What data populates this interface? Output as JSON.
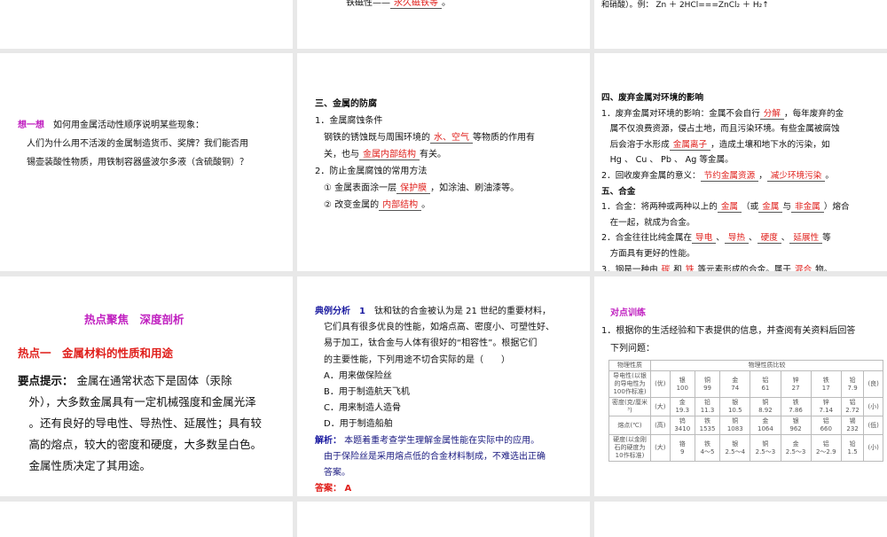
{
  "panels": [
    {
      "id": "p01",
      "lines": []
    },
    {
      "id": "p02",
      "lines": [
        [
          {
            "t": "铁磁性——"
          },
          {
            "t": "永久磁铁等",
            "f": 1
          },
          {
            "t": "。"
          }
        ]
      ]
    },
    {
      "id": "p03",
      "lines": [
        [
          {
            "t": "和硝酸）。例： Zn ＋ 2HCl===ZnCl₂ ＋ H₂↑"
          }
        ]
      ]
    },
    {
      "id": "p11",
      "lines": [
        [
          {
            "t": "想一想",
            "c": "mag"
          },
          {
            "t": "　如何用金属活动性顺序说明某些现象："
          }
        ],
        [
          {
            "t": "　人们为什么用不活泼的金属制造货币、奖牌？我们能否用"
          }
        ],
        [
          {
            "t": "　锡壶装酸性物质，用铁制容器盛波尔多液（含硫酸铜）？"
          }
        ]
      ]
    },
    {
      "id": "p12",
      "lines": [
        [
          {
            "t": "三、金属的防腐",
            "c": "b"
          }
        ],
        [
          {
            "t": "1．金属腐蚀条件"
          }
        ],
        [
          {
            "t": "　钢铁的锈蚀既与周围环境的"
          },
          {
            "t": "水、空气",
            "f": 1
          },
          {
            "t": "等物质的作用有"
          }
        ],
        [
          {
            "t": "　关，也与"
          },
          {
            "t": "金属内部结构",
            "f": 1
          },
          {
            "t": "有关。"
          }
        ],
        [
          {
            "t": "2．防止金属腐蚀的常用方法"
          }
        ],
        [
          {
            "t": "　① 金属表面涂一层"
          },
          {
            "t": "保护膜",
            "f": 1
          },
          {
            "t": "，如涂油、刷油漆等。"
          }
        ],
        [
          {
            "t": "　② 改变金属的"
          },
          {
            "t": "内部结构",
            "f": 1
          },
          {
            "t": "。"
          }
        ]
      ]
    },
    {
      "id": "p13",
      "lines": [
        [
          {
            "t": "四、废弃金属对环境的影响",
            "c": "b"
          }
        ],
        [
          {
            "t": "1．废弃金属对环境的影响：金属不会自行"
          },
          {
            "t": "分解",
            "f": 1
          },
          {
            "t": "，每年废弃的金"
          }
        ],
        [
          {
            "t": "　属不仅浪费资源，侵占土地，而且污染环境。有些金属被腐蚀"
          }
        ],
        [
          {
            "t": "　后会溶于水形成"
          },
          {
            "t": "金属离子",
            "f": 1
          },
          {
            "t": "，造成土壤和地下水的污染，如"
          }
        ],
        [
          {
            "t": "　Hg 、 Cu 、 Pb 、 Ag 等金属。"
          }
        ],
        [
          {
            "t": "2．回收废弃金属的意义："
          },
          {
            "t": "节约金属资源",
            "f": 1
          },
          {
            "t": "，"
          },
          {
            "t": "减少环境污染",
            "f": 1
          },
          {
            "t": "。"
          }
        ],
        [
          {
            "t": "五、合金",
            "c": "b"
          }
        ],
        [
          {
            "t": "1．合金：将两种或两种以上的"
          },
          {
            "t": "金属",
            "f": 1
          },
          {
            "t": "（或"
          },
          {
            "t": "金属",
            "f": 1
          },
          {
            "t": "与"
          },
          {
            "t": "非金属",
            "f": 1
          },
          {
            "t": "）熔合"
          }
        ],
        [
          {
            "t": "　在一起，就成为合金。"
          }
        ],
        [
          {
            "t": "2．合金往往比纯金属在"
          },
          {
            "t": "导电",
            "f": 1
          },
          {
            "t": "、"
          },
          {
            "t": "导热",
            "f": 1
          },
          {
            "t": "、"
          },
          {
            "t": "硬度",
            "f": 1
          },
          {
            "t": "、"
          },
          {
            "t": "延展性",
            "f": 1
          },
          {
            "t": "等"
          }
        ],
        [
          {
            "t": "　方面具有更好的性能。"
          }
        ],
        [
          {
            "t": "3．钢是一种由"
          },
          {
            "t": "碳",
            "f": 1
          },
          {
            "t": "和"
          },
          {
            "t": "铁",
            "f": 1
          },
          {
            "t": "等元素形成的合金。属于"
          },
          {
            "t": "混合",
            "f": 1
          },
          {
            "t": "物。"
          }
        ]
      ]
    },
    {
      "id": "p21",
      "lines": [
        [
          {
            "t": "　　　　　　热点聚焦　深度剖析",
            "c": "mag"
          }
        ],
        [
          {
            "t": "热点一　金属材料的性质和用途",
            "c": "red"
          }
        ],
        [
          {
            "t": "要点提示：",
            "c": "b"
          },
          {
            "t": " 金属在通常状态下是固体（汞除"
          }
        ],
        [
          {
            "t": "　外），大多数金属具有一定机械强度和金属光泽"
          }
        ],
        [
          {
            "t": "　。还有良好的导电性、导热性、延展性；具有较"
          }
        ],
        [
          {
            "t": "　高的熔点，较大的密度和硬度，大多数呈白色。"
          }
        ],
        [
          {
            "t": "　金属性质决定了其用途。"
          }
        ]
      ]
    },
    {
      "id": "p22",
      "lines": [
        [
          {
            "t": "典例分析　1",
            "c": "blue"
          },
          {
            "t": "　钛和钛的合金被认为是 21 世纪的重要材料，"
          }
        ],
        [
          {
            "t": "　它们具有很多优良的性能，如熔点高、密度小、可塑性好、"
          }
        ],
        [
          {
            "t": "　易于加工，钛合金与人体有很好的“相容性”。根据它们"
          }
        ],
        [
          {
            "t": "　的主要性能，下列用途不切合实际的是（　　）"
          }
        ],
        [
          {
            "t": "　A．用来做保险丝"
          }
        ],
        [
          {
            "t": "　B．用于制造航天飞机"
          }
        ],
        [
          {
            "t": "　C．用来制造人造骨"
          }
        ],
        [
          {
            "t": "　D．用于制造船舶"
          }
        ],
        [
          {
            "t": "解析：",
            "c": "blue"
          },
          {
            "t": " 本题着重考查学生理解金属性能在实际中的应用。",
            "c": "navy"
          }
        ],
        [
          {
            "t": "　由于保险丝是采用熔点低的合金材料制成，不难选出正确",
            "c": "navy"
          }
        ],
        [
          {
            "t": "　答案。",
            "c": "navy"
          }
        ],
        [
          {
            "t": "答案： A",
            "c": "red"
          }
        ]
      ]
    },
    {
      "id": "p23",
      "lines": [
        [
          {
            "t": "　对点训练",
            "c": "mag"
          }
        ],
        [
          {
            "t": "1．根据你的生活经验和下表提供的信息，并查阅有关资料后回答"
          }
        ],
        [
          {
            "t": "　下列问题："
          }
        ]
      ]
    }
  ],
  "table": {
    "header": [
      "物理性质",
      "物理性质比较"
    ],
    "rows": [
      {
        "name": "导电性(以银的导电性为100作标准)",
        "lo": "(优)",
        "hi": "(良)",
        "cells": [
          "银 100",
          "铜 99",
          "金 74",
          "铝 61",
          "锌 27",
          "铁 17",
          "铅 7.9"
        ]
      },
      {
        "name": "密度(克/厘米³)",
        "lo": "(大)",
        "hi": "(小)",
        "cells": [
          "金 19.3",
          "铅 11.3",
          "银 10.5",
          "铜 8.92",
          "铁 7.86",
          "锌 7.14",
          "铝 2.72"
        ]
      },
      {
        "name": "熔点(℃)",
        "lo": "(高)",
        "hi": "(低)",
        "cells": [
          "钨 3410",
          "铁 1535",
          "铜 1083",
          "金 1064",
          "银 962",
          "铝 660",
          "锡 232"
        ]
      },
      {
        "name": "硬度(以金刚石的硬度为10作标准)",
        "lo": "(大)",
        "hi": "(小)",
        "cells": [
          "铬 9",
          "铁 4～5",
          "银 2.5～4",
          "铜 2.5～3",
          "金 2.5～3",
          "铝 2～2.9",
          "铅 1.5"
        ]
      }
    ]
  }
}
